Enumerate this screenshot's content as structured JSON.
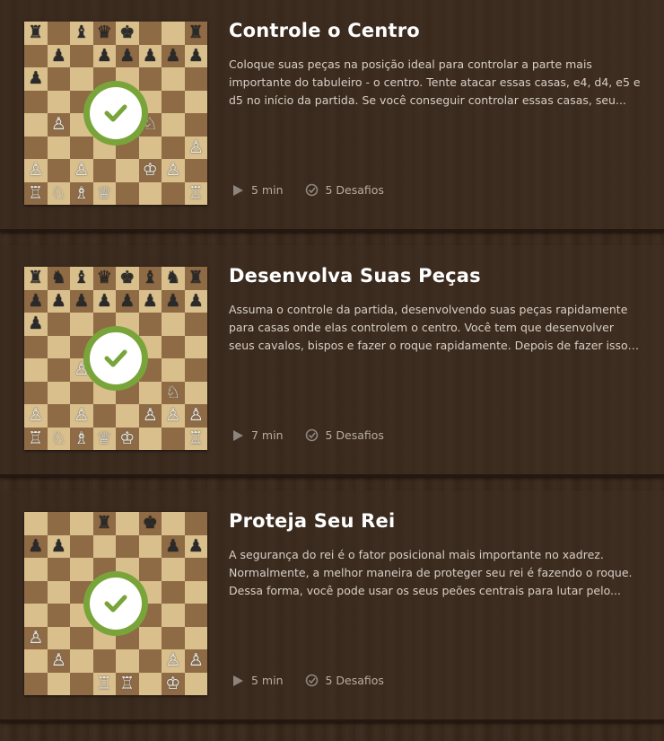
{
  "lessons": [
    {
      "title": "Controle o Centro",
      "description": "Coloque suas peças na posição ideal para controlar a parte mais importante do tabuleiro - o centro. Tente atacar essas casas, e4, d4, e5 e d5 no início da partida. Se você conseguir controlar essas casas, seu...",
      "duration": "5 min",
      "challenges": "5 Desafios",
      "completed": true,
      "board": [
        "r.bqk..r",
        ".p.ppppp",
        "p.......",
        "........",
        ".P.P.N..",
        ".......P",
        "P.P..KP.",
        "RNBQ...R"
      ]
    },
    {
      "title": "Desenvolva Suas Peças",
      "description": "Assuma o controle da partida, desenvolvendo suas peças rapidamente para casas onde elas controlem o centro. Você tem que desenvolver seus cavalos, bispos e fazer o roque rapidamente. Depois de fazer isso, é ho...",
      "duration": "7 min",
      "challenges": "5 Desafios",
      "completed": true,
      "board": [
        "rnbqkbnr",
        "pppppppp",
        "p.......",
        "........",
        "..PB....",
        "......N.",
        "P.P..PPP",
        "RNBQK..R"
      ]
    },
    {
      "title": "Proteja Seu Rei",
      "description": "A segurança do rei é o fator posicional mais importante no xadrez. Normalmente, a melhor maneira de proteger seu rei é fazendo o roque. Dessa forma, você pode usar os seus peões centrais para lutar pelo...",
      "duration": "5 min",
      "challenges": "5 Desafios",
      "completed": true,
      "board": [
        "...r.k..",
        "pp....pp",
        "........",
        "........",
        "........",
        "P.......",
        ".P....PP",
        "...RR.K."
      ]
    }
  ],
  "icons": {
    "play": "play-icon",
    "challenge": "checkmark-circle-icon",
    "completed": "checkmark-icon"
  },
  "colors": {
    "badge": "#79a43a",
    "light_square": "#d9bf8c",
    "dark_square": "#8e6a45"
  }
}
